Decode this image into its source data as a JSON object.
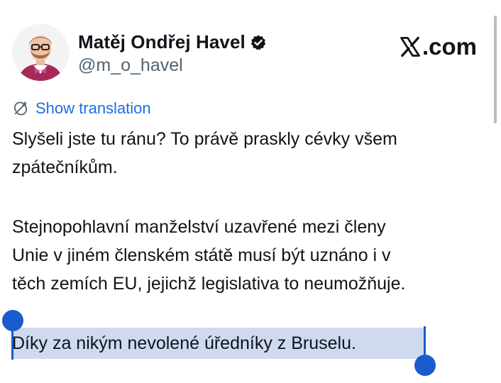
{
  "author": {
    "display_name": "Matěj Ondřej Havel",
    "handle": "@m_o_havel",
    "verified": true
  },
  "brand": {
    "text": ".com",
    "icon": "x-logo-icon"
  },
  "translate": {
    "label": "Show translation",
    "icon": "translate-icon"
  },
  "tweet": {
    "lines": [
      "Slyšeli jste tu ránu? To právě praskly cévky všem",
      "zpátečníkům.",
      "Stejnopohlavní manželství uzavřené mezi členy",
      "Unie v jiném členském státě musí být uznáno i v",
      "těch zemích EU, jejichž legislativa to neumožňuje.",
      "Díky za nikým nevolené úředníky z Bruselu."
    ]
  },
  "colors": {
    "link": "#1d6fe0",
    "selection": "#cfdaf0",
    "selection_handle": "#1a5ccc",
    "verified_badge": "#0f1419"
  }
}
